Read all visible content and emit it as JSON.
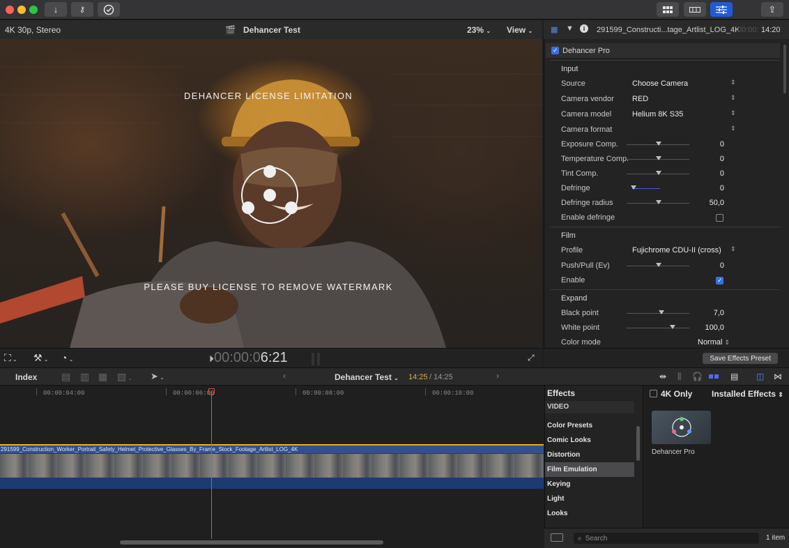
{
  "toolbar": {
    "icons": [
      "close",
      "minimize",
      "zoom",
      "import-icon",
      "keyword-icon",
      "checkmark-circle-icon",
      "browser-grid-icon",
      "timeline-icon",
      "inspector-icon",
      "share-icon"
    ]
  },
  "viewer": {
    "format": "4K 30p, Stereo",
    "project": "Dehancer Test",
    "zoom": "23%",
    "view_label": "View",
    "watermark_top": "DEHANCER LICENSE LIMITATION",
    "watermark_bottom": "PLEASE BUY LICENSE TO REMOVE WATERMARK",
    "timecode_dim": "00:00:0",
    "timecode_bright": "6:21"
  },
  "inspector": {
    "clip_name": "291599_Constructi...tage_Artlist_LOG_4K",
    "clip_tc_dim": "00:00:",
    "clip_tc": "14:20",
    "effect_name": "Dehancer Pro",
    "input": {
      "title": "Input",
      "source_label": "Source",
      "source_value": "Choose Camera",
      "vendor_label": "Camera vendor",
      "vendor_value": "RED",
      "model_label": "Camera model",
      "model_value": "Helium 8K S35",
      "format_label": "Camera format",
      "exposure_label": "Exposure Comp.",
      "exposure_value": "0",
      "temperature_label": "Temperature Comp.",
      "temperature_value": "0",
      "tint_label": "Tint Comp.",
      "tint_value": "0",
      "defringe_label": "Defringe",
      "defringe_value": "0",
      "defringe_radius_label": "Defringe radius",
      "defringe_radius_value": "50,0",
      "enable_defringe_label": "Enable defringe"
    },
    "film": {
      "title": "Film",
      "profile_label": "Profile",
      "profile_value": "Fujichrome CDU-II (cross)",
      "pushpull_label": "Push/Pull (Ev)",
      "pushpull_value": "0",
      "enable_label": "Enable"
    },
    "expand": {
      "title": "Expand",
      "black_label": "Black point",
      "black_value": "7,0",
      "white_label": "White point",
      "white_value": "100,0",
      "color_mode_label": "Color mode",
      "color_mode_value": "Normal"
    },
    "save_preset": "Save Effects Preset"
  },
  "timeline": {
    "index_label": "Index",
    "project": "Dehancer Test",
    "tc_current": "14:25",
    "tc_total": "/ 14:25",
    "ruler": [
      "00:00:04:00",
      "00:00:06:00",
      "00:00:08:00",
      "00:00:10:00"
    ],
    "clip_name": "291599_Construction_Worker_Portrait_Safety_Helmet_Protective_Glasses_By_Frame_Stock_Footage_Artlist_LOG_4K"
  },
  "effects": {
    "title": "Effects",
    "category_header": "VIDEO",
    "categories": [
      "Color Presets",
      "Comic Looks",
      "Distortion",
      "Film Emulation",
      "Keying",
      "Light",
      "Looks"
    ],
    "four_k_only": "4K Only",
    "installed": "Installed Effects",
    "item_name": "Dehancer Pro",
    "search_placeholder": "Search",
    "count": "1 item"
  }
}
